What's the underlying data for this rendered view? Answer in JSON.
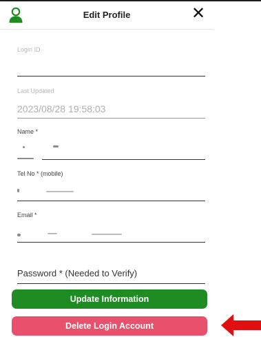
{
  "header": {
    "title": "Edit Profile",
    "close_glyph": "✕",
    "avatar_icon": "user-icon"
  },
  "form": {
    "login_id": {
      "label": "Login ID",
      "value": ""
    },
    "last_updated": {
      "label": "Last Updated",
      "value": "2023/08/28 19:58:03"
    },
    "name": {
      "label": "Name *"
    },
    "tel": {
      "label": "Tel No * (mobile)"
    },
    "email": {
      "label": "Email *"
    },
    "password": {
      "placeholder": "Password * (Needed to Verify)"
    }
  },
  "buttons": {
    "update": "Update Information",
    "delete": "Delete Login Account"
  },
  "colors": {
    "update_button": "#1e8c23",
    "delete_button": "#e8506b",
    "avatar": "#1e8c23",
    "annotation_arrow": "#e01010"
  },
  "annotation": {
    "icon": "arrow-left-icon"
  }
}
